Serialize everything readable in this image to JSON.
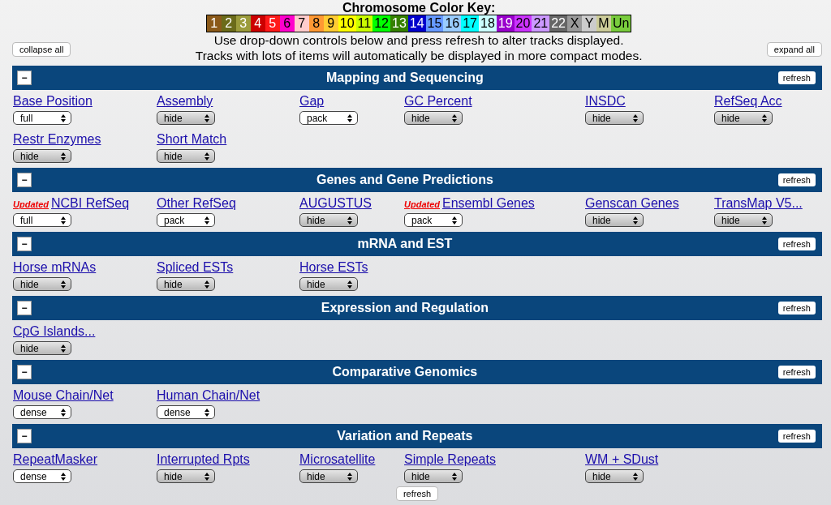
{
  "color_key": {
    "title": "Chromosome Color Key:",
    "chromosomes": [
      {
        "label": "1",
        "color": "#8b5a1a",
        "light_text": true
      },
      {
        "label": "2",
        "color": "#6b6b1a",
        "light_text": true
      },
      {
        "label": "3",
        "color": "#9c9c3c",
        "light_text": true
      },
      {
        "label": "4",
        "color": "#cc0000",
        "light_text": true
      },
      {
        "label": "5",
        "color": "#ff1a1a",
        "light_text": true
      },
      {
        "label": "6",
        "color": "#ff00cc",
        "light_text": false
      },
      {
        "label": "7",
        "color": "#ffcccc",
        "light_text": false
      },
      {
        "label": "8",
        "color": "#ff9933",
        "light_text": false
      },
      {
        "label": "9",
        "color": "#ffcc33",
        "light_text": false
      },
      {
        "label": "10",
        "color": "#ffff00",
        "light_text": false
      },
      {
        "label": "11",
        "color": "#ccff00",
        "light_text": false
      },
      {
        "label": "12",
        "color": "#00ff00",
        "light_text": false
      },
      {
        "label": "13",
        "color": "#358000",
        "light_text": true
      },
      {
        "label": "14",
        "color": "#0000cc",
        "light_text": true
      },
      {
        "label": "15",
        "color": "#6699ff",
        "light_text": false
      },
      {
        "label": "16",
        "color": "#99ccff",
        "light_text": false
      },
      {
        "label": "17",
        "color": "#00ffff",
        "light_text": false
      },
      {
        "label": "18",
        "color": "#ccffff",
        "light_text": false
      },
      {
        "label": "19",
        "color": "#9900cc",
        "light_text": true
      },
      {
        "label": "20",
        "color": "#cc33ff",
        "light_text": false
      },
      {
        "label": "21",
        "color": "#cc99ff",
        "light_text": false
      },
      {
        "label": "22",
        "color": "#666666",
        "light_text": true
      },
      {
        "label": "X",
        "color": "#999999",
        "light_text": false
      },
      {
        "label": "Y",
        "color": "#cccccc",
        "light_text": false
      },
      {
        "label": "M",
        "color": "#cccc99",
        "light_text": false
      },
      {
        "label": "Un",
        "color": "#79cc3d",
        "light_text": false
      }
    ]
  },
  "instructions": [
    "Use drop-down controls below and press refresh to alter tracks displayed.",
    "Tracks with lots of items will automatically be displayed in more compact modes."
  ],
  "collapse_all": "collapse all",
  "expand_all": "expand all",
  "sections": [
    {
      "title": "Mapping and Sequencing",
      "toggle": "−",
      "refresh": "refresh",
      "rows": [
        [
          {
            "name": "Base Position",
            "mode": "full",
            "hidden": false
          },
          {
            "name": "Assembly",
            "mode": "hide",
            "hidden": true
          },
          {
            "name": "Gap",
            "mode": "pack",
            "hidden": false
          },
          {
            "name": "GC Percent",
            "mode": "hide",
            "hidden": true
          },
          {
            "name": "INSDC",
            "mode": "hide",
            "hidden": true
          },
          {
            "name": "RefSeq Acc",
            "mode": "hide",
            "hidden": true
          }
        ],
        [
          {
            "name": "Restr Enzymes",
            "mode": "hide",
            "hidden": true
          },
          {
            "name": "Short Match",
            "mode": "hide",
            "hidden": true
          }
        ]
      ]
    },
    {
      "title": "Genes and Gene Predictions",
      "toggle": "−",
      "refresh": "refresh",
      "rows": [
        [
          {
            "name": "NCBI RefSeq",
            "mode": "full",
            "hidden": false,
            "badge": "Updated"
          },
          {
            "name": "Other RefSeq",
            "mode": "pack",
            "hidden": false
          },
          {
            "name": "AUGUSTUS",
            "mode": "hide",
            "hidden": true
          },
          {
            "name": "Ensembl Genes",
            "mode": "pack",
            "hidden": false,
            "badge": "Updated"
          },
          {
            "name": "Genscan Genes",
            "mode": "hide",
            "hidden": true
          },
          {
            "name": "TransMap V5...",
            "mode": "hide",
            "hidden": true
          }
        ]
      ]
    },
    {
      "title": "mRNA and EST",
      "toggle": "−",
      "refresh": "refresh",
      "rows": [
        [
          {
            "name": "Horse mRNAs",
            "mode": "hide",
            "hidden": true
          },
          {
            "name": "Spliced ESTs",
            "mode": "hide",
            "hidden": true
          },
          {
            "name": "Horse ESTs",
            "mode": "hide",
            "hidden": true
          }
        ]
      ]
    },
    {
      "title": "Expression and Regulation",
      "toggle": "−",
      "refresh": "refresh",
      "rows": [
        [
          {
            "name": "CpG Islands...",
            "mode": "hide",
            "hidden": true
          }
        ]
      ]
    },
    {
      "title": "Comparative Genomics",
      "toggle": "−",
      "refresh": "refresh",
      "rows": [
        [
          {
            "name": "Mouse Chain/Net",
            "mode": "dense",
            "hidden": false
          },
          {
            "name": "Human Chain/Net",
            "mode": "dense",
            "hidden": false
          }
        ]
      ]
    },
    {
      "title": "Variation and Repeats",
      "toggle": "−",
      "refresh": "refresh",
      "rows": [
        [
          {
            "name": "RepeatMasker",
            "mode": "dense",
            "hidden": false
          },
          {
            "name": "Interrupted Rpts",
            "mode": "hide",
            "hidden": true
          },
          {
            "name": "Microsatellite",
            "mode": "hide",
            "hidden": true
          },
          {
            "name": "Simple Repeats",
            "mode": "hide",
            "hidden": true
          },
          {
            "name": "WM + SDust",
            "mode": "hide",
            "hidden": true
          }
        ]
      ]
    }
  ],
  "bottom_refresh": "refresh"
}
